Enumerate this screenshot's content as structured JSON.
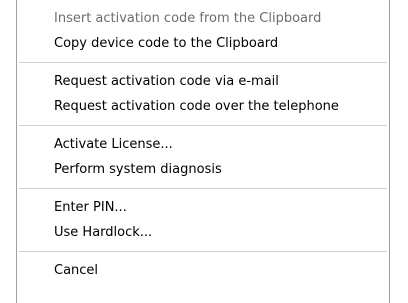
{
  "menu": {
    "items": [
      {
        "label": "Insert activation code from the Clipboard",
        "disabled": true
      },
      {
        "label": "Copy device code to the Clipboard"
      },
      {
        "label": "Request activation code via e-mail"
      },
      {
        "label": "Request activation code over the telephone"
      },
      {
        "label": "Activate License..."
      },
      {
        "label": "Perform system diagnosis"
      },
      {
        "label": "Enter PIN..."
      },
      {
        "label": "Use Hardlock..."
      },
      {
        "label": "Cancel"
      }
    ]
  }
}
